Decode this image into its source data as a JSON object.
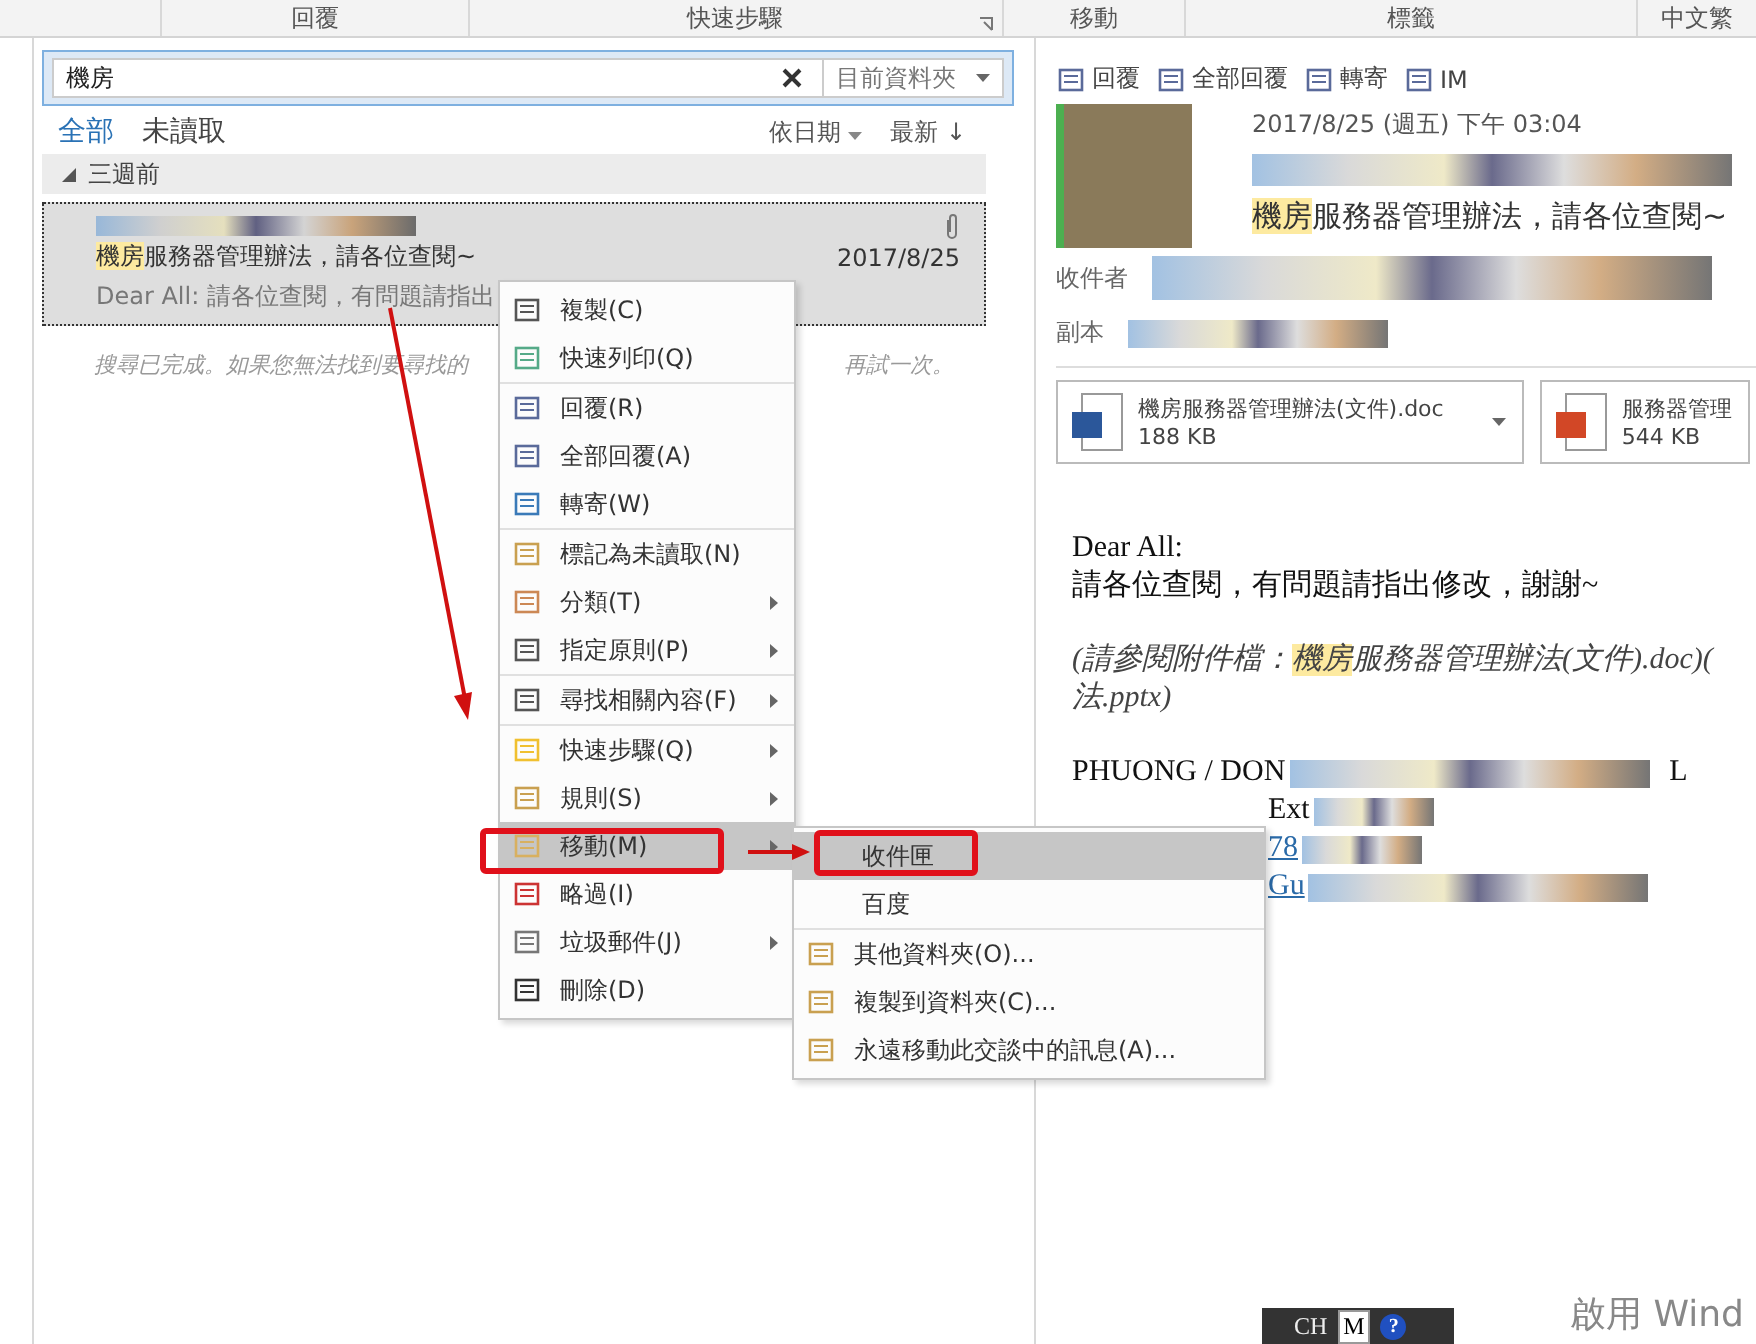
{
  "ribbon": {
    "groups": [
      {
        "label": "回覆",
        "launcher": false
      },
      {
        "label": "快速步驟",
        "launcher": true
      },
      {
        "label": "移動",
        "launcher": false
      },
      {
        "label": "標籤",
        "launcher": false
      },
      {
        "label": "中文繁",
        "launcher": false
      }
    ]
  },
  "search": {
    "value": "機房",
    "scope": "目前資料夾"
  },
  "filters": [
    {
      "label": "全部",
      "selected": true
    },
    {
      "label": "未讀取",
      "selected": false
    }
  ],
  "sort": {
    "by": "依日期",
    "order": "最新 ↓"
  },
  "group_header": {
    "label": "三週前",
    "expanded": true
  },
  "message": {
    "subject_highlight": "機房",
    "subject_rest": "服務器管理辦法，請各位查閱~",
    "date": "2017/8/25",
    "preview": "Dear All:  請各位查閱，有問題請指出",
    "attachment": true
  },
  "search_hint": {
    "before": "搜尋已完成。如果您無法找到要尋找的",
    "after": "再試一次。"
  },
  "context_menu": [
    {
      "label": "複製(C)",
      "submenu": false,
      "separator_before": false,
      "selected": false
    },
    {
      "label": "快速列印(Q)",
      "submenu": false,
      "separator_before": false,
      "selected": false
    },
    {
      "label": "回覆(R)",
      "submenu": false,
      "separator_before": true,
      "selected": false
    },
    {
      "label": "全部回覆(A)",
      "submenu": false,
      "separator_before": false,
      "selected": false
    },
    {
      "label": "轉寄(W)",
      "submenu": false,
      "separator_before": false,
      "selected": false
    },
    {
      "label": "標記為未讀取(N)",
      "submenu": false,
      "separator_before": true,
      "selected": false
    },
    {
      "label": "分類(T)",
      "submenu": true,
      "separator_before": false,
      "selected": false
    },
    {
      "label": "指定原則(P)",
      "submenu": true,
      "separator_before": false,
      "selected": false
    },
    {
      "label": "尋找相關內容(F)",
      "submenu": true,
      "separator_before": true,
      "selected": false
    },
    {
      "label": "快速步驟(Q)",
      "submenu": true,
      "separator_before": true,
      "selected": false
    },
    {
      "label": "規則(S)",
      "submenu": true,
      "separator_before": false,
      "selected": false
    },
    {
      "label": "移動(M)",
      "submenu": true,
      "separator_before": false,
      "selected": true
    },
    {
      "label": "略過(I)",
      "submenu": false,
      "separator_before": false,
      "selected": false
    },
    {
      "label": "垃圾郵件(J)",
      "submenu": true,
      "separator_before": false,
      "selected": false
    },
    {
      "label": "刪除(D)",
      "submenu": false,
      "separator_before": false,
      "selected": false
    }
  ],
  "submenu": [
    {
      "label": "收件匣",
      "icon": false,
      "separator_before": false,
      "selected": true
    },
    {
      "label": "百度",
      "icon": false,
      "separator_before": false,
      "selected": false
    },
    {
      "label": "其他資料夾(O)...",
      "icon": true,
      "separator_before": true,
      "selected": false
    },
    {
      "label": "複製到資料夾(C)...",
      "icon": true,
      "separator_before": false,
      "selected": false
    },
    {
      "label": "永遠移動此交談中的訊息(A)...",
      "icon": true,
      "separator_before": false,
      "selected": false
    }
  ],
  "reading": {
    "actions": [
      "回覆",
      "全部回覆",
      "轉寄",
      "IM"
    ],
    "date": "2017/8/25 (週五) 下午 03:04",
    "subject_highlight": "機房",
    "subject_rest": "服務器管理辦法，請各位查閱~",
    "to_label": "收件者",
    "cc_label": "副本",
    "attachments": [
      {
        "kind": "word",
        "name": "機房服務器管理辦法(文件).doc",
        "size": "188 KB",
        "menu": true
      },
      {
        "kind": "powerpoint",
        "name": "服務器管理",
        "size": "544 KB",
        "menu": false
      }
    ],
    "body": {
      "greeting": "Dear All:",
      "line": "請各位查閱，有問題請指出修改，謝謝~",
      "note_before": "(請參閱附件檔：",
      "note_highlight": "機房",
      "note_after": "服務器管理辦法(文件).doc)(",
      "note_line2": "法.pptx)",
      "signature": [
        {
          "kind": "text",
          "text": "PHUONG / DON",
          "tail": "L"
        },
        {
          "kind": "text",
          "text": "Ext"
        },
        {
          "kind": "link",
          "text": "78"
        },
        {
          "kind": "link",
          "text": "Gu"
        }
      ]
    }
  },
  "ime_bar": {
    "lang": "CH",
    "mode": "M",
    "help": "?"
  },
  "activation": "啟用 Wind"
}
